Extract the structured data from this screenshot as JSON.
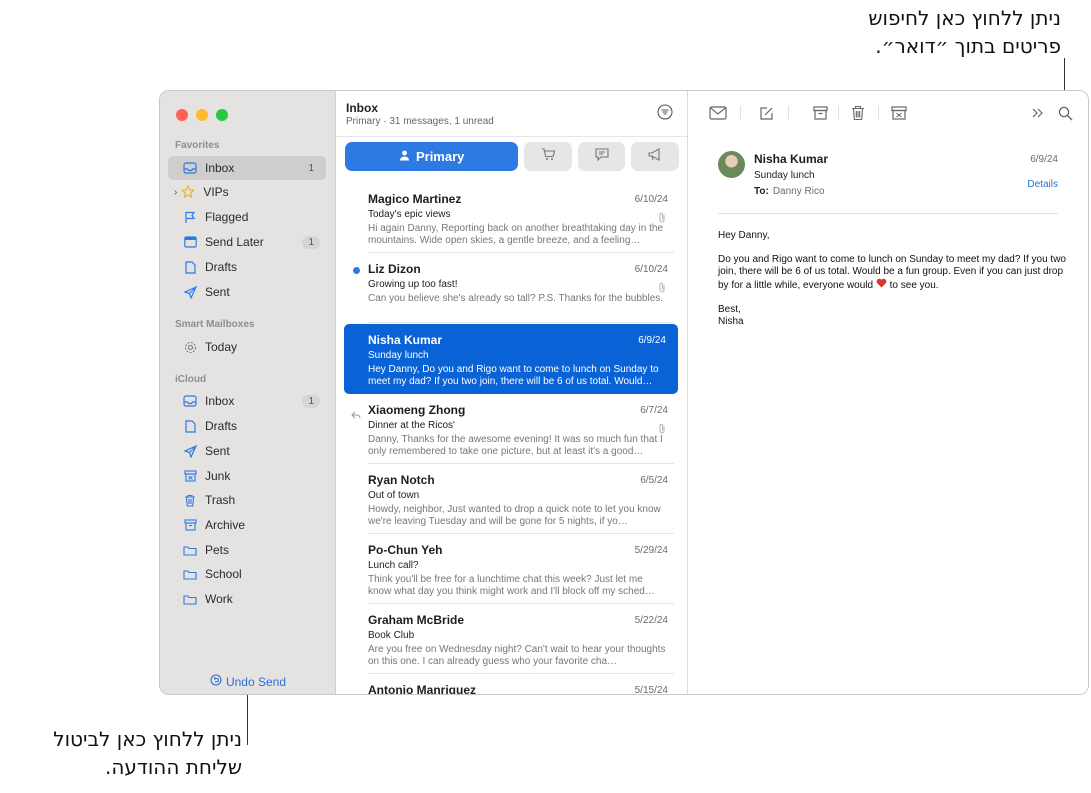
{
  "callouts": {
    "search_line1": "ניתן ללחוץ כאן לחיפוש",
    "search_line2": "פריטים בתוך ״דואר״.",
    "undo_line1": "ניתן ללחוץ כאן לביטול",
    "undo_line2": "שליחת ההודעה."
  },
  "sidebar": {
    "favorites_title": "Favorites",
    "favorites": [
      {
        "label": "Inbox",
        "icon": "inbox-icon",
        "badge": "1"
      },
      {
        "label": "VIPs",
        "icon": "star-icon",
        "badge": ""
      },
      {
        "label": "Flagged",
        "icon": "flag-icon",
        "badge": ""
      },
      {
        "label": "Send Later",
        "icon": "calendar-icon",
        "badge": "1"
      },
      {
        "label": "Drafts",
        "icon": "document-icon",
        "badge": ""
      },
      {
        "label": "Sent",
        "icon": "paper-plane-icon",
        "badge": ""
      }
    ],
    "smart_title": "Smart Mailboxes",
    "smart": [
      {
        "label": "Today",
        "icon": "gear-icon",
        "badge": ""
      }
    ],
    "icloud_title": "iCloud",
    "icloud": [
      {
        "label": "Inbox",
        "icon": "inbox-icon",
        "badge": "1"
      },
      {
        "label": "Drafts",
        "icon": "document-icon",
        "badge": ""
      },
      {
        "label": "Sent",
        "icon": "paper-plane-icon",
        "badge": ""
      },
      {
        "label": "Junk",
        "icon": "junk-icon",
        "badge": ""
      },
      {
        "label": "Trash",
        "icon": "trash-icon",
        "badge": ""
      },
      {
        "label": "Archive",
        "icon": "archive-icon",
        "badge": ""
      },
      {
        "label": "Pets",
        "icon": "folder-icon",
        "badge": ""
      },
      {
        "label": "School",
        "icon": "folder-icon",
        "badge": ""
      },
      {
        "label": "Work",
        "icon": "folder-icon",
        "badge": ""
      }
    ],
    "undo_send": "Undo Send"
  },
  "list": {
    "title": "Inbox",
    "subtitle": "Primary · 31 messages, 1 unread",
    "primary_tab": "Primary",
    "messages": [
      {
        "from": "Magico Martinez",
        "date": "6/10/24",
        "subject": "Today's epic views",
        "snippet": "Hi again Danny, Reporting back on another breathtaking day in the mountains. Wide open skies, a gentle breeze, and a feeling…"
      },
      {
        "from": "Liz Dizon",
        "date": "6/10/24",
        "subject": "Growing up too fast!",
        "snippet": "Can you believe she's already so tall? P.S. Thanks for the bubbles."
      },
      {
        "from": "Nisha Kumar",
        "date": "6/9/24",
        "subject": "Sunday lunch",
        "snippet": "Hey Danny, Do you and Rigo want to come to lunch on Sunday to meet my dad? If you two join, there will be 6 of us total. Would…"
      },
      {
        "from": "Xiaomeng Zhong",
        "date": "6/7/24",
        "subject": "Dinner at the Ricos'",
        "snippet": "Danny, Thanks for the awesome evening! It was so much fun that I only remembered to take one picture, but at least it's a good…"
      },
      {
        "from": "Ryan Notch",
        "date": "6/5/24",
        "subject": "Out of town",
        "snippet": "Howdy, neighbor, Just wanted to drop a quick note to let you know we're leaving Tuesday and will be gone for 5 nights, if yo…"
      },
      {
        "from": "Po-Chun Yeh",
        "date": "5/29/24",
        "subject": "Lunch call?",
        "snippet": "Think you'll be free for a lunchtime chat this week? Just let me know what day you think might work and I'll block off my sched…"
      },
      {
        "from": "Graham McBride",
        "date": "5/22/24",
        "subject": "Book Club",
        "snippet": "Are you free on Wednesday night? Can't wait to hear your thoughts on this one. I can already guess who your favorite cha…"
      },
      {
        "from": "Antonio Manriquez",
        "date": "5/15/24",
        "subject": "",
        "snippet": ""
      }
    ]
  },
  "reader": {
    "from": "Nisha Kumar",
    "subject": "Sunday lunch",
    "to_label": "To:",
    "to": "Danny Rico",
    "date": "6/9/24",
    "details": "Details",
    "greeting": "Hey Danny,",
    "body_before_heart": "Do you and Rigo want to come to lunch on Sunday to meet my dad? If you two join, there will be 6 of us total. Would be a fun group. Even if you can just drop by for a little while, everyone would",
    "body_after_heart": " to see you.",
    "signoff": "Best,",
    "signature": "Nisha"
  },
  "colors": {
    "accent": "#2d7ae3",
    "selected_row": "#0a63d6",
    "sidebar_bg": "#e5e3e2"
  }
}
